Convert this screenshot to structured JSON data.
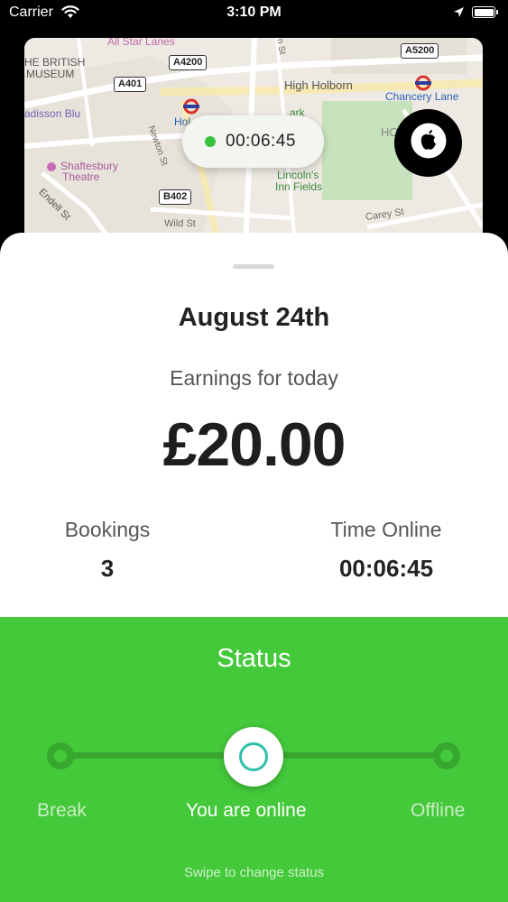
{
  "status_bar": {
    "carrier": "Carrier",
    "time": "3:10 PM"
  },
  "map": {
    "labels": {
      "all_star_lanes": "All Star Lanes",
      "british_museum_1": "HE BRITISH",
      "british_museum_2": "MUSEUM",
      "radisson": "adisson Blu",
      "high_holborn": "High Holborn",
      "chancery_lane": "Chancery Lane",
      "holborn_station": "Hol",
      "holborn_area": "HOLB",
      "newton_st": "Newton St",
      "shaftesbury_1": "Shaftesbury",
      "shaftesbury_2": "Theatre",
      "endell_st": "Endell St",
      "wild_st": "Wild St",
      "lincolns_1": "Lincoln's",
      "lincolns_2": "Inn Fields",
      "carey_st": "Carey St",
      "park": "ark",
      "n_st": "n St"
    },
    "shields": {
      "a4200": "A4200",
      "a401": "A401",
      "a5200": "A5200",
      "b402": "B402"
    },
    "timer": "00:06:45"
  },
  "sheet": {
    "date": "August 24th",
    "earnings_label": "Earnings for today",
    "earnings_amount": "£20.00",
    "bookings_label": "Bookings",
    "bookings_value": "3",
    "time_online_label": "Time Online",
    "time_online_value": "00:06:45"
  },
  "status": {
    "title": "Status",
    "options": {
      "break": "Break",
      "online": "You are online",
      "offline": "Offline"
    },
    "selected": "online",
    "hint": "Swipe to change status"
  },
  "colors": {
    "accent": "#44c93a",
    "track": "#37a82e",
    "knob_ring": "#2fbfa8"
  }
}
